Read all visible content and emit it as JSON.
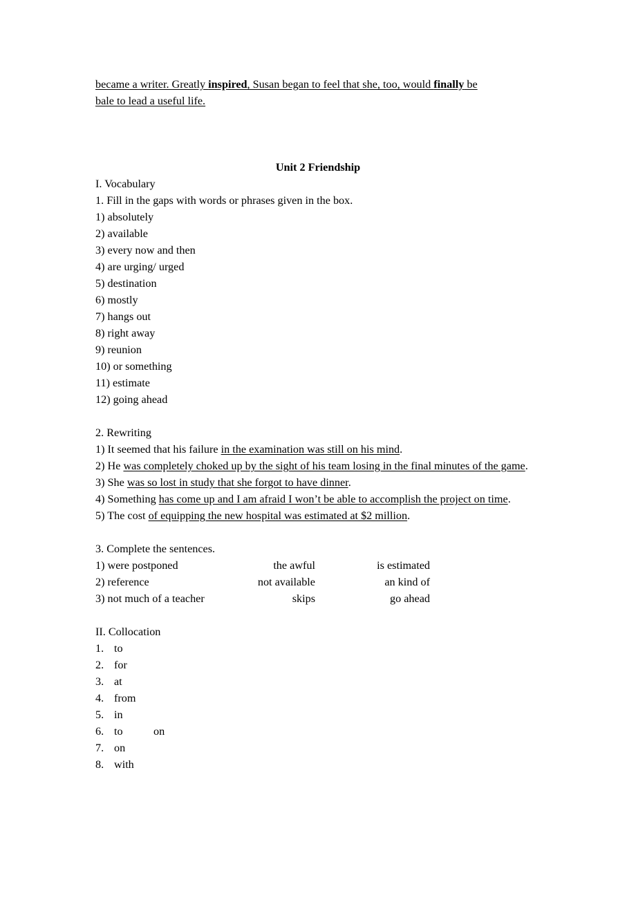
{
  "document": {
    "continuation": {
      "segments": [
        {
          "text": "became a writer. Greatly ",
          "bold": false
        },
        {
          "text": "inspired",
          "bold": true
        },
        {
          "text": ", Susan began to feel that she, too, would ",
          "bold": false
        },
        {
          "text": "finally",
          "bold": true
        },
        {
          "text": " be bale to lead a useful life.",
          "bold": false
        }
      ],
      "line1_part1": "became a writer. Greatly ",
      "line1_bold1": "inspired",
      "line1_part2": ", Susan began to feel that she, too, would ",
      "line1_bold2": "finally",
      "line1_part3": " be",
      "line2": "bale to lead a useful life."
    },
    "title": "Unit 2 Friendship",
    "sections": [
      {
        "heading": "I. Vocabulary",
        "subheading": "1. Fill in the gaps with words or phrases given in the box.",
        "items": [
          "1) absolutely",
          "2) available",
          "3) every now and then",
          "4) are urging/ urged",
          "5) destination",
          "6) mostly",
          "7) hangs out",
          "8) right away",
          "9) reunion",
          "10) or something",
          "11) estimate",
          "12) going ahead"
        ]
      },
      {
        "heading": "2. Rewriting",
        "items": [
          {
            "plain": "1) It seemed that his failure ",
            "underlined": "in the examination was still on his mind",
            "tail": "."
          },
          {
            "plain": "2) He ",
            "underlined": "was completely choked up by the sight of his team losing in the final minutes of the game",
            "tail": "."
          },
          {
            "plain": "3) She ",
            "underlined": "was so lost in study that she forgot to have dinner",
            "tail": "."
          },
          {
            "plain": "4) Something ",
            "underlined": "has come up and I am afraid I won’t be able to accomplish the project on time",
            "tail": "."
          },
          {
            "plain": "5) The cost ",
            "underlined": "of equipping the new hospital was estimated at $2 million",
            "tail": "."
          }
        ]
      },
      {
        "heading": "3. Complete the sentences.",
        "rows": [
          {
            "col1": "1) were postponed",
            "col2": "the awful",
            "col3": "is estimated"
          },
          {
            "col1": "2) reference",
            "col2": "not available",
            "col3": "an kind of"
          },
          {
            "col1": "3) not much of a teacher",
            "col2": "skips",
            "col3": "go ahead"
          }
        ]
      },
      {
        "heading": "II. Collocation",
        "items": [
          {
            "number": "1.",
            "word1": "to",
            "word2": ""
          },
          {
            "number": "2.",
            "word1": "for",
            "word2": ""
          },
          {
            "number": "3.",
            "word1": "at",
            "word2": ""
          },
          {
            "number": "4.",
            "word1": "from",
            "word2": ""
          },
          {
            "number": "5.",
            "word1": "in",
            "word2": ""
          },
          {
            "number": "6.",
            "word1": "to",
            "word2": "on"
          },
          {
            "number": "7.",
            "word1": "on",
            "word2": ""
          },
          {
            "number": "8.",
            "word1": "with",
            "word2": ""
          }
        ]
      }
    ]
  }
}
